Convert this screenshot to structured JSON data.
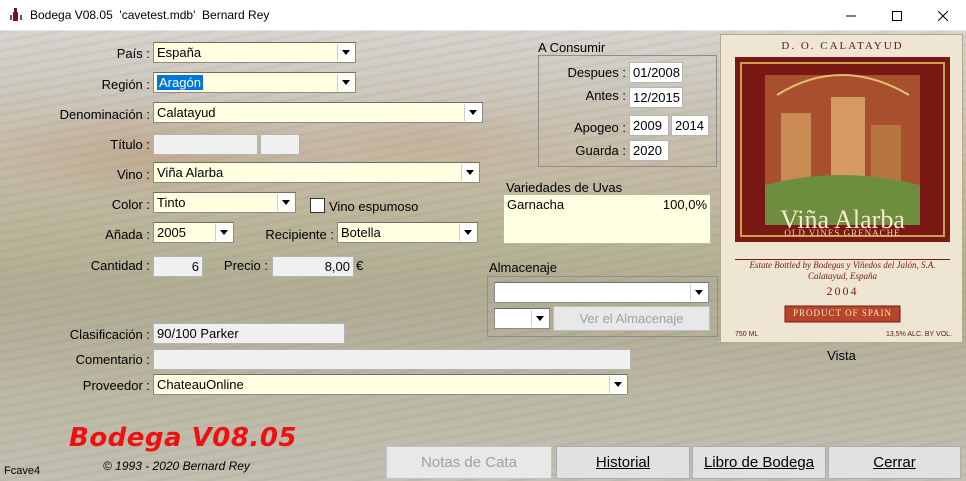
{
  "window": {
    "title": "Bodega V08.05  'cavetest.mdb'  Bernard Rey",
    "minimize_icon": "minimize-icon",
    "maximize_icon": "maximize-icon",
    "close_icon": "close-icon"
  },
  "form": {
    "pais": {
      "label": "País :",
      "value": "España"
    },
    "region": {
      "label": "Región :",
      "value": "Aragón"
    },
    "denominacion": {
      "label": "Denominación :",
      "value": "Calatayud"
    },
    "titulo": {
      "label": "Título :",
      "value": "",
      "value2": ""
    },
    "vino": {
      "label": "Vino :",
      "value": "Viña Alarba"
    },
    "color": {
      "label": "Color :",
      "value": "Tinto"
    },
    "espumoso": {
      "label": "Vino espumoso",
      "checked": false
    },
    "anada": {
      "label": "Añada :",
      "value": "2005"
    },
    "recipiente": {
      "label": "Recipiente :",
      "value": "Botella"
    },
    "cantidad": {
      "label": "Cantidad :",
      "value": "6"
    },
    "precio": {
      "label": "Precio :",
      "value": "8,00",
      "currency": "€"
    },
    "clasificacion": {
      "label": "Clasificación :",
      "value": "90/100 Parker"
    },
    "comentario": {
      "label": "Comentario :",
      "value": ""
    },
    "proveedor": {
      "label": "Proveedor :",
      "value": "ChateauOnline"
    }
  },
  "consumir": {
    "title": "A Consumir",
    "despues": {
      "label": "Despues :",
      "value": "01/2008"
    },
    "antes": {
      "label": "Antes :",
      "value": "12/2015"
    },
    "apogeo": {
      "label": "Apogeo :",
      "value_from": "2009",
      "value_to": "2014"
    },
    "guarda": {
      "label": "Guarda :",
      "value": "2020"
    }
  },
  "variedades": {
    "title": "Variedades de Uvas",
    "items": [
      {
        "name": "Garnacha",
        "pct": "100,0%"
      }
    ]
  },
  "almacenaje": {
    "title": "Almacenaje",
    "location": "",
    "slot": "",
    "button": "Ver el Almacenaje"
  },
  "wine_label": {
    "do": "D. O. CALATAYUD",
    "name": "Viña Alarba",
    "subname": "OLD VINES GRENACHE",
    "bottled": "Estate Bottled by Bodegas y Viñedos del Jalón, S.A.",
    "place": "Calatayud, España",
    "year": "2004",
    "product": "PRODUCT OF SPAIN",
    "volume": "750 ML",
    "alcohol": "13,5% ALC. BY VOL.",
    "caption": "Vista"
  },
  "footer": {
    "brand": "Bodega V08.05",
    "copyright": "© 1993 - 2020 Bernard Rey",
    "form_name": "Fcave4",
    "buttons": {
      "notas": "Notas de Cata",
      "historial": "Historial",
      "libro": "Libro de Bodega",
      "cerrar": "Cerrar"
    }
  },
  "colors": {
    "field_bg": "#ffffe1",
    "selection": "#0078d7",
    "brand_red": "#f01010",
    "label_red": "#8b1a12"
  }
}
